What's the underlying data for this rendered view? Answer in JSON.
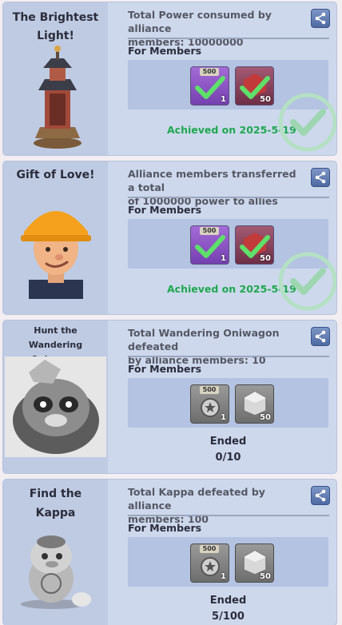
{
  "colors": {
    "card_bg": "#cdd8ec",
    "left_bg": "#bfcbe3",
    "achieved": "#1ea84f",
    "text": "#2b2d3c",
    "desc": "#555864"
  },
  "cards": [
    {
      "title_line1": "The Brightest",
      "title_line2": "Light!",
      "description_line1": "Total Power consumed by alliance",
      "description_line2": "members: 10000000",
      "members_label": "For Members",
      "rewards": [
        {
          "badge": "500",
          "qty": "1"
        },
        {
          "qty": "50"
        }
      ],
      "status": "Achieved on 2025-5-19"
    },
    {
      "title_line1": "Gift of Love!",
      "description_line1": "Alliance members transferred a total",
      "description_line2": "of 1000000 power to allies",
      "members_label": "For Members",
      "rewards": [
        {
          "badge": "500",
          "qty": "1"
        },
        {
          "qty": "50"
        }
      ],
      "status": "Achieved on 2025-5-19"
    },
    {
      "title_line1": "Hunt the Wandering",
      "title_line2": "Oniwagon",
      "description_line1": "Total Wandering Oniwagon defeated",
      "description_line2": "by alliance members: 10",
      "members_label": "For Members",
      "rewards": [
        {
          "badge": "500",
          "qty": "1"
        },
        {
          "qty": "50"
        }
      ],
      "status": "Ended",
      "progress": "0/10"
    },
    {
      "title_line1": "Find the",
      "title_line2": "Kappa",
      "description_line1": "Total Kappa defeated by alliance",
      "description_line2": "members: 100",
      "members_label": "For Members",
      "rewards": [
        {
          "badge": "500",
          "qty": "1"
        },
        {
          "qty": "50"
        }
      ],
      "status": "Ended",
      "progress": "5/100"
    }
  ],
  "icons": [
    "share-icon",
    "checkmark-icon",
    "tower-icon",
    "worker-avatar-icon",
    "oniwagon-icon",
    "kappa-icon",
    "medal-icon",
    "crystal-icon"
  ]
}
